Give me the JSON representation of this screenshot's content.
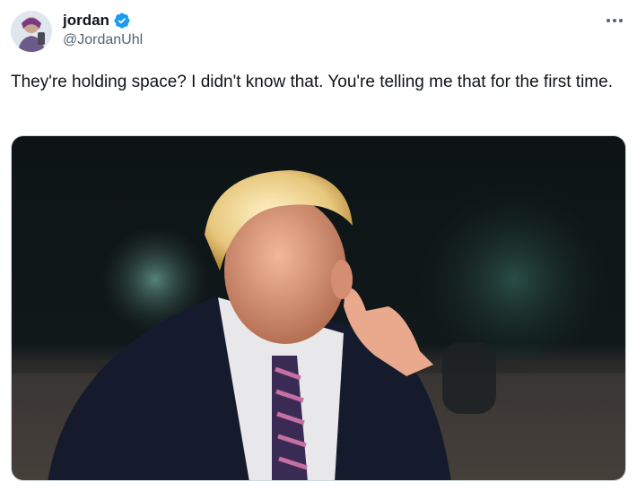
{
  "author": {
    "display_name": "jordan",
    "handle": "@JordanUhl",
    "verified": true,
    "verified_color": "#1d9bf0",
    "avatar_icon": "avatar-icon"
  },
  "tweet": {
    "text": "They're holding space? I didn't know that. You're telling me that for the first time."
  },
  "media": {
    "kind": "photo"
  },
  "icons": {
    "more": "more-horizontal-icon",
    "verified": "verified-badge-icon"
  },
  "colors": {
    "text_primary": "#0f1419",
    "text_secondary": "#536471",
    "accent": "#1d9bf0"
  }
}
